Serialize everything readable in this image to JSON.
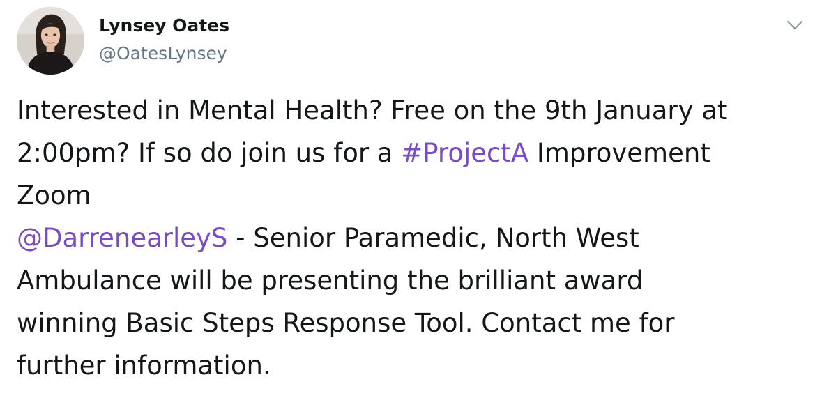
{
  "tweet": {
    "author": {
      "display_name": "Lynsey Oates",
      "handle": "@OatesLynsey"
    },
    "menu_icon": "chevron-down-icon",
    "accent_color": "#794bc4",
    "text": {
      "line1": "Interested in Mental Health? Free on the 9th January at",
      "line2_prefix": "2:00pm? If so do join us for a ",
      "hashtag": "#ProjectA",
      "line2_suffix": " Improvement",
      "line3": "Zoom",
      "mention": "@DarrenearleyS",
      "line4_suffix": " - Senior Paramedic, North West",
      "line5": "Ambulance will be presenting the brilliant award",
      "line6": "winning Basic Steps Response Tool. Contact me for",
      "line7": "further information."
    }
  }
}
